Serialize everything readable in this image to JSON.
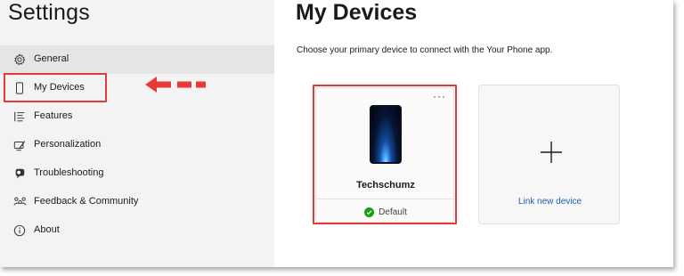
{
  "sidebar": {
    "title": "Settings",
    "items": [
      {
        "label": "General",
        "icon": "gear-icon",
        "selected": true
      },
      {
        "label": "My Devices",
        "icon": "phone-icon",
        "selected": false
      },
      {
        "label": "Features",
        "icon": "features-list-icon",
        "selected": false
      },
      {
        "label": "Personalization",
        "icon": "paint-icon",
        "selected": false
      },
      {
        "label": "Troubleshooting",
        "icon": "troubleshoot-icon",
        "selected": false
      },
      {
        "label": "Feedback & Community",
        "icon": "community-icon",
        "selected": false
      },
      {
        "label": "About",
        "icon": "info-icon",
        "selected": false
      }
    ]
  },
  "main": {
    "title": "My Devices",
    "subtitle": "Choose your primary device to connect with the Your Phone app.",
    "device": {
      "name": "Techschumz",
      "status": "Default",
      "more_label": "···"
    },
    "link_card": {
      "label": "Link new device"
    }
  },
  "colors": {
    "highlight_red": "#e8393a",
    "link_blue": "#1a5fb4",
    "success_green": "#13a10e",
    "sidebar_bg": "#f3f3f3",
    "selected_bg": "#e5e5e5"
  }
}
